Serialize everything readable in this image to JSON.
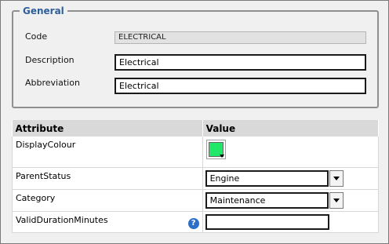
{
  "general": {
    "legend": "General",
    "fields": [
      {
        "label": "Code",
        "value": "ELECTRICAL"
      },
      {
        "label": "Description",
        "value": "Electrical"
      },
      {
        "label": "Abbreviation",
        "value": "Electrical"
      }
    ]
  },
  "attributes": {
    "headers": {
      "attribute": "Attribute",
      "value": "Value"
    },
    "rows": [
      {
        "name": "DisplayColour",
        "colour": "#22e86a"
      },
      {
        "name": "ParentStatus",
        "selected": "Engine"
      },
      {
        "name": "Category",
        "selected": "Maintenance"
      },
      {
        "name": "ValidDurationMinutes",
        "value": "",
        "help_icon": "help-icon",
        "help_glyph": "?"
      }
    ]
  }
}
